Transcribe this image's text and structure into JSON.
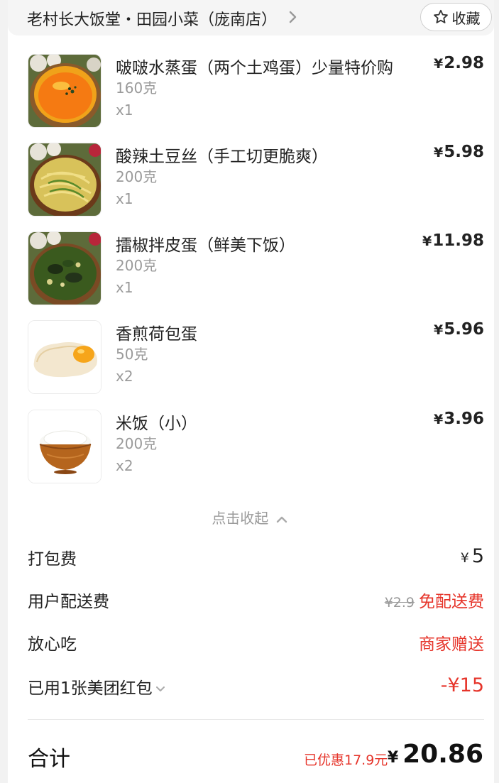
{
  "store": {
    "name": "老村长大饭堂・田园小菜（庞南店）",
    "favorite_label": "收藏"
  },
  "items": [
    {
      "name": "啵啵水蒸蛋（两个土鸡蛋）少量特价购",
      "weight": "160克",
      "qty": "x1",
      "currency": "¥",
      "price": "2.98",
      "image": "steamed-egg-image"
    },
    {
      "name": "酸辣土豆丝（手工切更脆爽）",
      "weight": "200克",
      "qty": "x1",
      "currency": "¥",
      "price": "5.98",
      "image": "potato-shreds-image"
    },
    {
      "name": "擂椒拌皮蛋（鲜美下饭）",
      "weight": "200克",
      "qty": "x1",
      "currency": "¥",
      "price": "11.98",
      "image": "century-egg-image"
    },
    {
      "name": "香煎荷包蛋",
      "weight": "50克",
      "qty": "x2",
      "currency": "¥",
      "price": "5.96",
      "image": "fried-egg-image"
    },
    {
      "name": "米饭（小）",
      "weight": "200克",
      "qty": "x2",
      "currency": "¥",
      "price": "3.96",
      "image": "rice-bowl-image"
    }
  ],
  "collapse_label": "点击收起",
  "fees": {
    "packing": {
      "label": "打包费",
      "currency": "¥",
      "value": "5"
    },
    "delivery": {
      "label": "用户配送费",
      "original": "¥2.9",
      "value": "免配送费"
    },
    "assurance": {
      "label": "放心吃",
      "value": "商家赠送"
    },
    "redpacket": {
      "label": "已用1张美团红包",
      "value": "-¥15"
    }
  },
  "total": {
    "label": "合计",
    "saved": "已优惠17.9元",
    "currency": "¥",
    "value": "20.86"
  },
  "colors": {
    "accent_red": "#e6352b",
    "muted_text": "#9a9a9a"
  }
}
